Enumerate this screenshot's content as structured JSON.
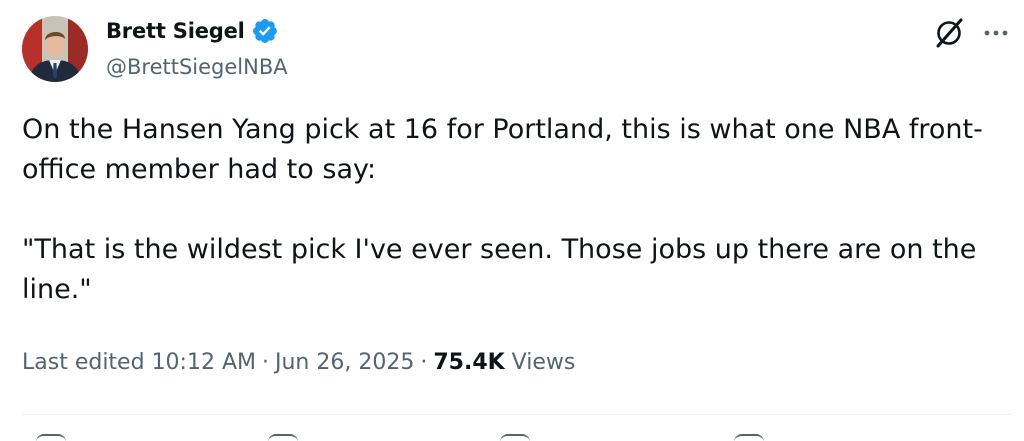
{
  "tweet": {
    "author": {
      "display_name": "Brett Siegel",
      "handle": "@BrettSiegelNBA",
      "verified": true,
      "verified_color": "#1d9bf0"
    },
    "text_paragraphs": [
      "On the Hansen Yang pick at 16 for Portland, this is what one NBA front-office member had to say:",
      "\"That is the wildest pick I've ever seen. Those jobs up there are on the line.\""
    ],
    "meta": {
      "edited_prefix": "Last edited",
      "time": "10:12 AM",
      "date": "Jun 26, 2025",
      "views_count": "75.4K",
      "views_label": "Views"
    },
    "icons": {
      "grok": "grok-icon",
      "more": "more-icon",
      "verified": "verified-badge-icon"
    },
    "colors": {
      "text_primary": "#0f1419",
      "text_secondary": "#536471",
      "divider": "#eff3f4"
    }
  }
}
